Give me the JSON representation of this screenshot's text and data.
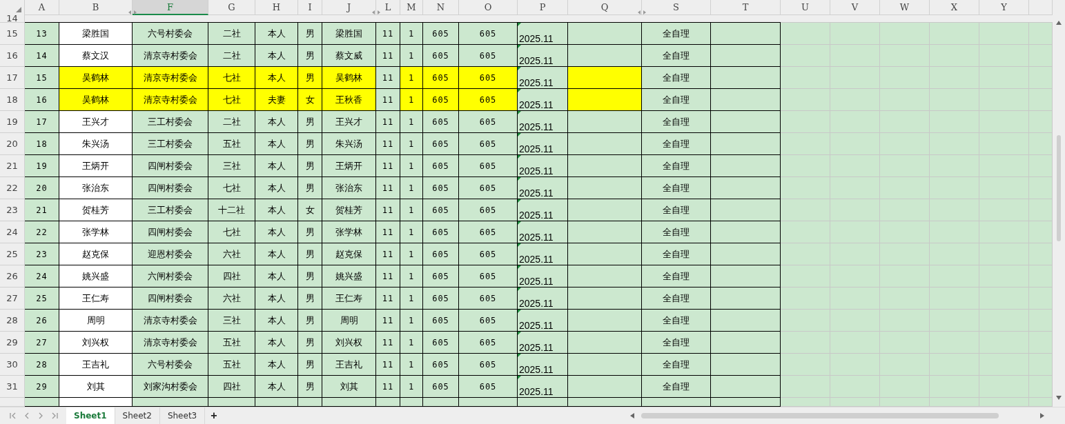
{
  "columns": [
    {
      "label": "A",
      "selected": false
    },
    {
      "label": "B",
      "selected": false
    },
    {
      "label": "F",
      "selected": true
    },
    {
      "label": "G",
      "selected": false
    },
    {
      "label": "H",
      "selected": false
    },
    {
      "label": "I",
      "selected": false
    },
    {
      "label": "J",
      "selected": false
    },
    {
      "label": "L",
      "selected": false
    },
    {
      "label": "M",
      "selected": false
    },
    {
      "label": "N",
      "selected": false
    },
    {
      "label": "O",
      "selected": false
    },
    {
      "label": "P",
      "selected": false
    },
    {
      "label": "Q",
      "selected": false
    },
    {
      "label": "S",
      "selected": false
    },
    {
      "label": "T",
      "selected": false
    },
    {
      "label": "U",
      "selected": false
    },
    {
      "label": "V",
      "selected": false
    },
    {
      "label": "W",
      "selected": false
    },
    {
      "label": "X",
      "selected": false
    },
    {
      "label": "Y",
      "selected": false
    }
  ],
  "top_row_header": "14",
  "rows": [
    {
      "row": "15",
      "no": "13",
      "name": "梁胜国",
      "village": "六号村委会",
      "group": "二社",
      "relation": "本人",
      "gender": "男",
      "member": "梁胜国",
      "l": "11",
      "m": "1",
      "n": "605",
      "o": "605",
      "date": "2025.11",
      "status": "全自理",
      "highlighted": false
    },
    {
      "row": "16",
      "no": "14",
      "name": "蔡文汉",
      "village": "清京寺村委会",
      "group": "二社",
      "relation": "本人",
      "gender": "男",
      "member": "蔡文威",
      "l": "11",
      "m": "1",
      "n": "605",
      "o": "605",
      "date": "2025.11",
      "status": "全自理",
      "highlighted": false
    },
    {
      "row": "17",
      "no": "15",
      "name": "吴鹤林",
      "village": "清京寺村委会",
      "group": "七社",
      "relation": "本人",
      "gender": "男",
      "member": "吴鹤林",
      "l": "11",
      "m": "1",
      "n": "605",
      "o": "605",
      "date": "2025.11",
      "status": "全自理",
      "highlighted": true
    },
    {
      "row": "18",
      "no": "16",
      "name": "吴鹤林",
      "village": "清京寺村委会",
      "group": "七社",
      "relation": "夫妻",
      "gender": "女",
      "member": "王秋香",
      "l": "11",
      "m": "1",
      "n": "605",
      "o": "605",
      "date": "2025.11",
      "status": "全自理",
      "highlighted": true
    },
    {
      "row": "19",
      "no": "17",
      "name": "王兴才",
      "village": "三工村委会",
      "group": "二社",
      "relation": "本人",
      "gender": "男",
      "member": "王兴才",
      "l": "11",
      "m": "1",
      "n": "605",
      "o": "605",
      "date": "2025.11",
      "status": "全自理",
      "highlighted": false
    },
    {
      "row": "20",
      "no": "18",
      "name": "朱兴汤",
      "village": "三工村委会",
      "group": "五社",
      "relation": "本人",
      "gender": "男",
      "member": "朱兴汤",
      "l": "11",
      "m": "1",
      "n": "605",
      "o": "605",
      "date": "2025.11",
      "status": "全自理",
      "highlighted": false
    },
    {
      "row": "21",
      "no": "19",
      "name": "王炳开",
      "village": "四闸村委会",
      "group": "三社",
      "relation": "本人",
      "gender": "男",
      "member": "王炳开",
      "l": "11",
      "m": "1",
      "n": "605",
      "o": "605",
      "date": "2025.11",
      "status": "全自理",
      "highlighted": false
    },
    {
      "row": "22",
      "no": "20",
      "name": "张治东",
      "village": "四闸村委会",
      "group": "七社",
      "relation": "本人",
      "gender": "男",
      "member": "张治东",
      "l": "11",
      "m": "1",
      "n": "605",
      "o": "605",
      "date": "2025.11",
      "status": "全自理",
      "highlighted": false
    },
    {
      "row": "23",
      "no": "21",
      "name": "贺桂芳",
      "village": "三工村委会",
      "group": "十二社",
      "relation": "本人",
      "gender": "女",
      "member": "贺桂芳",
      "l": "11",
      "m": "1",
      "n": "605",
      "o": "605",
      "date": "2025.11",
      "status": "全自理",
      "highlighted": false
    },
    {
      "row": "24",
      "no": "22",
      "name": "张学林",
      "village": "四闸村委会",
      "group": "七社",
      "relation": "本人",
      "gender": "男",
      "member": "张学林",
      "l": "11",
      "m": "1",
      "n": "605",
      "o": "605",
      "date": "2025.11",
      "status": "全自理",
      "highlighted": false
    },
    {
      "row": "25",
      "no": "23",
      "name": "赵克保",
      "village": "迎恩村委会",
      "group": "六社",
      "relation": "本人",
      "gender": "男",
      "member": "赵克保",
      "l": "11",
      "m": "1",
      "n": "605",
      "o": "605",
      "date": "2025.11",
      "status": "全自理",
      "highlighted": false
    },
    {
      "row": "26",
      "no": "24",
      "name": "姚兴盛",
      "village": "六闸村委会",
      "group": "四社",
      "relation": "本人",
      "gender": "男",
      "member": "姚兴盛",
      "l": "11",
      "m": "1",
      "n": "605",
      "o": "605",
      "date": "2025.11",
      "status": "全自理",
      "highlighted": false
    },
    {
      "row": "27",
      "no": "25",
      "name": "王仁寿",
      "village": "四闸村委会",
      "group": "六社",
      "relation": "本人",
      "gender": "男",
      "member": "王仁寿",
      "l": "11",
      "m": "1",
      "n": "605",
      "o": "605",
      "date": "2025.11",
      "status": "全自理",
      "highlighted": false
    },
    {
      "row": "28",
      "no": "26",
      "name": "周明",
      "village": "清京寺村委会",
      "group": "三社",
      "relation": "本人",
      "gender": "男",
      "member": "周明",
      "l": "11",
      "m": "1",
      "n": "605",
      "o": "605",
      "date": "2025.11",
      "status": "全自理",
      "highlighted": false
    },
    {
      "row": "29",
      "no": "27",
      "name": "刘兴权",
      "village": "清京寺村委会",
      "group": "五社",
      "relation": "本人",
      "gender": "男",
      "member": "刘兴权",
      "l": "11",
      "m": "1",
      "n": "605",
      "o": "605",
      "date": "2025.11",
      "status": "全自理",
      "highlighted": false
    },
    {
      "row": "30",
      "no": "28",
      "name": "王吉礼",
      "village": "六号村委会",
      "group": "五社",
      "relation": "本人",
      "gender": "男",
      "member": "王吉礼",
      "l": "11",
      "m": "1",
      "n": "605",
      "o": "605",
      "date": "2025.11",
      "status": "全自理",
      "highlighted": false
    },
    {
      "row": "31",
      "no": "29",
      "name": "刘其",
      "village": "刘家沟村委会",
      "group": "四社",
      "relation": "本人",
      "gender": "男",
      "member": "刘其",
      "l": "11",
      "m": "1",
      "n": "605",
      "o": "605",
      "date": "2025.11",
      "status": "全自理",
      "highlighted": false
    }
  ],
  "sheet_tabs": [
    {
      "label": "Sheet1",
      "selected": true
    },
    {
      "label": "Sheet2",
      "selected": false
    },
    {
      "label": "Sheet3",
      "selected": false
    }
  ],
  "add_sheet": "+"
}
